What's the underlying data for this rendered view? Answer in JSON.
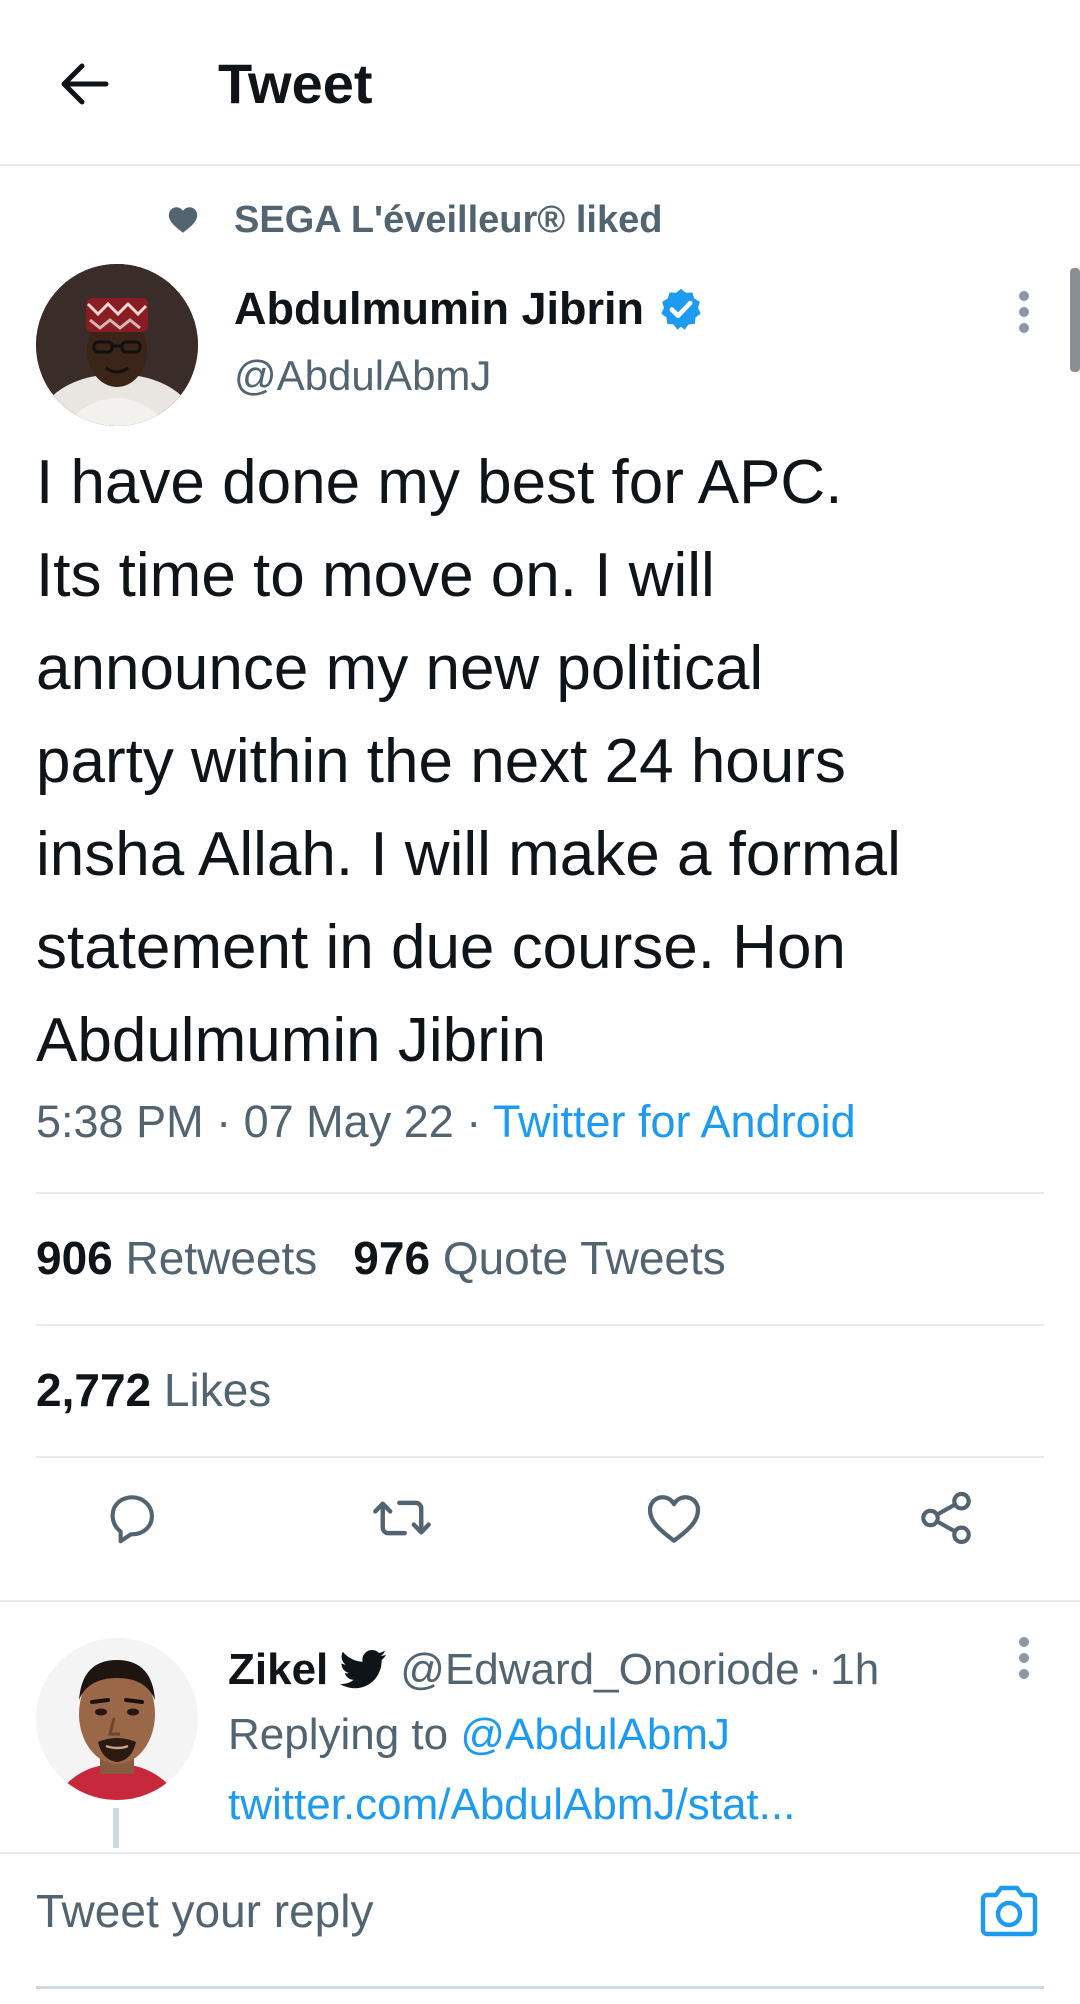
{
  "header": {
    "title": "Tweet",
    "back_icon": "arrow-left-icon"
  },
  "social_context": {
    "text": "SEGA L'éveilleur® liked",
    "icon": "heart-filled-icon"
  },
  "tweet": {
    "author_name": "Abdulmumin Jibrin",
    "author_handle": "@AbdulAbmJ",
    "verified": true,
    "text": "I have done my best for APC.\nIts time to move on. I will\nannounce my new political\nparty within the next 24 hours\ninsha Allah. I will make a formal\nstatement in due course. Hon\nAbdulmumin Jibrin",
    "time": "5:38 PM",
    "date": "07 May 22",
    "separator": "·",
    "source": "Twitter for Android"
  },
  "stats": {
    "retweets_count": "906",
    "retweets_label": "Retweets",
    "quotes_count": "976",
    "quotes_label": "Quote Tweets",
    "likes_count": "2,772",
    "likes_label": "Likes"
  },
  "actions": [
    "reply-icon",
    "retweet-icon",
    "like-icon",
    "share-icon"
  ],
  "reply": {
    "name": "Zikel",
    "handle": "@Edward_Onoriode",
    "dot": "·",
    "time": "1h",
    "replying_prefix": "Replying to ",
    "replying_to": "@AbdulAbmJ",
    "link": "twitter.com/AbdulAbmJ/stat..."
  },
  "composer": {
    "placeholder": "Tweet your reply",
    "value": ""
  },
  "colors": {
    "accent": "#1d9bf0",
    "text_primary": "#0f1419",
    "text_secondary": "#536471",
    "divider": "#e6ecf0"
  }
}
